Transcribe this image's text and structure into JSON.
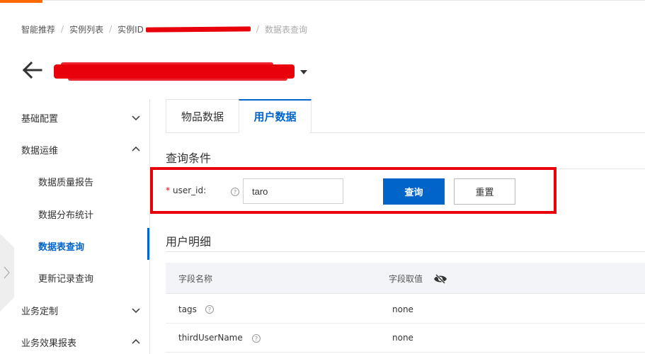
{
  "breadcrumb": {
    "items": [
      "智能推荐",
      "实例列表",
      "实例ID",
      "数据表查询"
    ]
  },
  "sidebar": {
    "items": [
      {
        "label": "基础配置"
      },
      {
        "label": "数据运维"
      },
      {
        "label": "数据质量报告"
      },
      {
        "label": "数据分布统计"
      },
      {
        "label": "数据表查询"
      },
      {
        "label": "更新记录查询"
      },
      {
        "label": "业务定制"
      },
      {
        "label": "业务效果报表"
      }
    ]
  },
  "tabs": [
    {
      "label": "物品数据"
    },
    {
      "label": "用户数据"
    }
  ],
  "query": {
    "section_title": "查询条件",
    "required_mark": "*",
    "field_label": "user_id:",
    "field_value": "taro",
    "help_glyph": "?",
    "query_button": "查询",
    "reset_button": "重置"
  },
  "details": {
    "section_title": "用户明细",
    "columns": [
      "字段名称",
      "字段取值"
    ],
    "rows": [
      {
        "name": "tags",
        "value": "none"
      },
      {
        "name": "thirdUserName",
        "value": "none"
      }
    ]
  },
  "colors": {
    "primary": "#0064c8",
    "highlight_red": "#e8000b",
    "accent_orange": "#ff6a00"
  },
  "icons": [
    "back-arrow-icon",
    "chevron-down-icon",
    "chevron-up-icon",
    "help-icon",
    "eye-slash-icon",
    "caret-down-icon"
  ]
}
